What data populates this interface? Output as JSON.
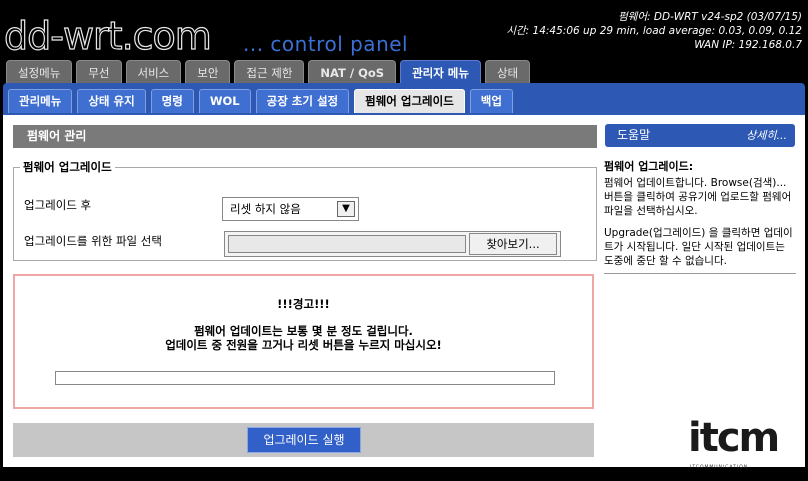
{
  "header": {
    "logo_text": "dd-wrt",
    "logo_dot": ".com",
    "tagline": "... control panel",
    "firmware_line": "펌웨어: DD-WRT v24-sp2 (03/07/15)",
    "time_line": "시간: 14:45:06 up 29 min, load average: 0.03, 0.09, 0.12",
    "wan_line": "WAN IP: 192.168.0.7"
  },
  "main_tabs": [
    "설정메뉴",
    "무선",
    "서비스",
    "보안",
    "접근 제한",
    "NAT / QoS",
    "관리자 메뉴",
    "상태"
  ],
  "sub_tabs": [
    "관리메뉴",
    "상태 유지",
    "명령",
    "WOL",
    "공장 초기 설정",
    "펌웨어 업그레이드",
    "백업"
  ],
  "section": {
    "title": "펌웨어 관리",
    "legend": "펌웨어 업그레이드",
    "after_label": "업그레이드 후",
    "after_value": "리셋 하지 않음",
    "file_label": "업그레이드를 위한 파일 선택",
    "browse_label": "찾아보기..."
  },
  "warning": {
    "title": "!!!경고!!!",
    "line1": "펌웨어 업데이트는 보통 몇 분 정도 걸립니다.",
    "line2": "업데이트 중 전원을 끄거나 리셋 버튼을 누르지 마십시오!",
    "progress": 0
  },
  "action": {
    "upgrade_label": "업그레이드 실행"
  },
  "help": {
    "title": "도움말",
    "more": "상세히...",
    "heading": "펌웨어 업그레이드:",
    "para1": "펌웨어 업데이트합니다. Browse(검색)... 버튼을 클릭하여 공유기에 업로드할 펌웨어 파일을 선택하십시오.",
    "para2": "Upgrade(업그레이드) 을 클릭하면 업데이트가 시작됩니다. 일단 시작된 업데이트는 도중에 중단 할 수 없습니다."
  },
  "watermark": {
    "letters": "itcm",
    "sub": "ITCOMMUNICATION"
  }
}
